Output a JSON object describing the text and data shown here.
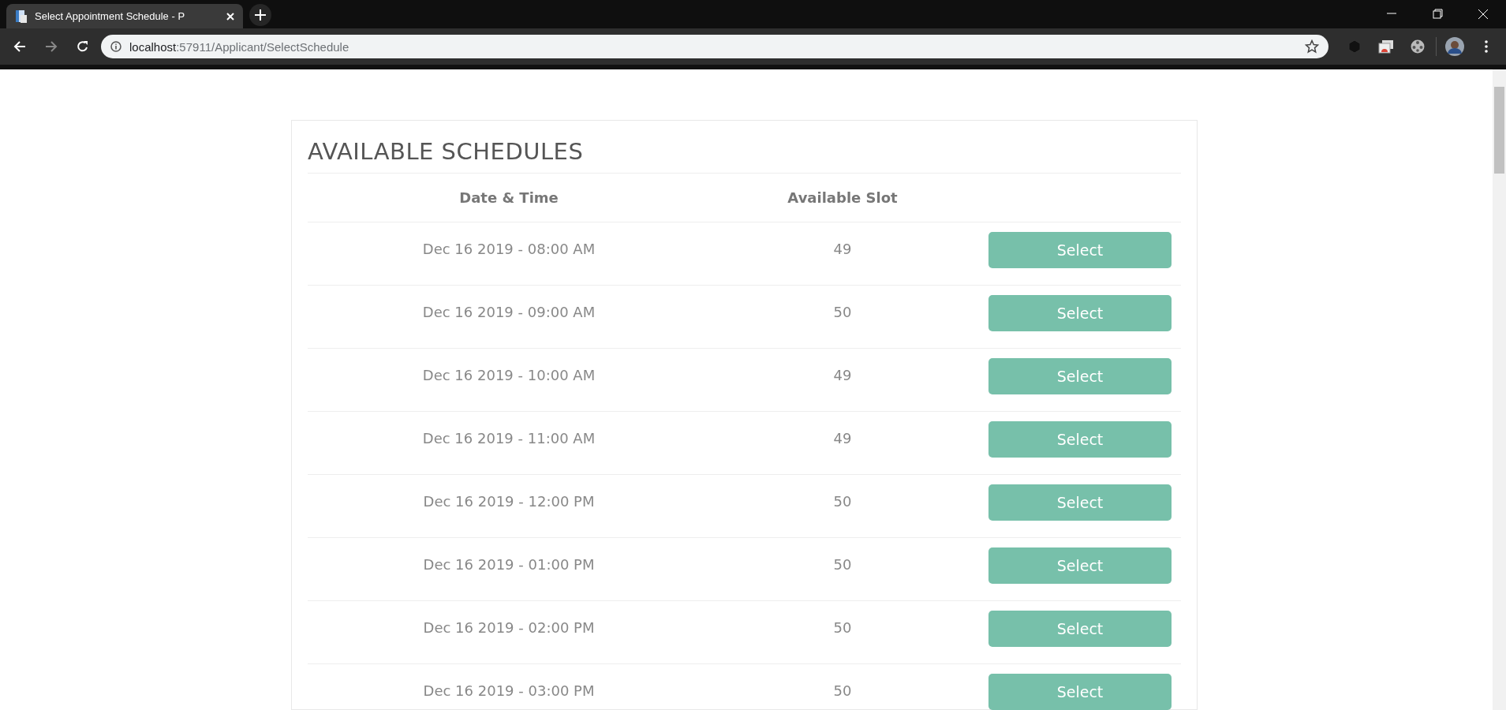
{
  "browser": {
    "tab_title": "Select Appointment Schedule - P",
    "url_host": "localhost",
    "url_path": ":57911/Applicant/SelectSchedule"
  },
  "card": {
    "title": "AVAILABLE SCHEDULES",
    "columns": [
      "Date & Time",
      "Available Slot"
    ],
    "rows": [
      {
        "date_time": "Dec 16 2019 - 08:00 AM",
        "slots": "49",
        "action": "Select"
      },
      {
        "date_time": "Dec 16 2019 - 09:00 AM",
        "slots": "50",
        "action": "Select"
      },
      {
        "date_time": "Dec 16 2019 - 10:00 AM",
        "slots": "49",
        "action": "Select"
      },
      {
        "date_time": "Dec 16 2019 - 11:00 AM",
        "slots": "49",
        "action": "Select"
      },
      {
        "date_time": "Dec 16 2019 - 12:00 PM",
        "slots": "50",
        "action": "Select"
      },
      {
        "date_time": "Dec 16 2019 - 01:00 PM",
        "slots": "50",
        "action": "Select"
      },
      {
        "date_time": "Dec 16 2019 - 02:00 PM",
        "slots": "50",
        "action": "Select"
      },
      {
        "date_time": "Dec 16 2019 - 03:00 PM",
        "slots": "50",
        "action": "Select"
      }
    ]
  }
}
